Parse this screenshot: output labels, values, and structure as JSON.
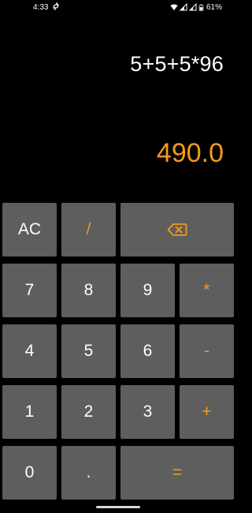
{
  "status_bar": {
    "time": "4:33",
    "battery": "61%",
    "icons": [
      "sync-icon",
      "wifi-icon",
      "signal-icon",
      "signal-icon",
      "battery-icon"
    ]
  },
  "display": {
    "expression": "5+5+5*96",
    "result": "490.0"
  },
  "keys": {
    "ac": "AC",
    "divide": "/",
    "backspace_icon": "backspace-icon",
    "seven": "7",
    "eight": "8",
    "nine": "9",
    "multiply": "*",
    "four": "4",
    "five": "5",
    "six": "6",
    "minus": "-",
    "one": "1",
    "two": "2",
    "three": "3",
    "plus": "+",
    "zero": "0",
    "dot": ".",
    "equals": "="
  },
  "colors": {
    "background": "#000000",
    "key": "#5E5E5E",
    "accent": "#F59A1C",
    "text": "#FFFFFF"
  }
}
